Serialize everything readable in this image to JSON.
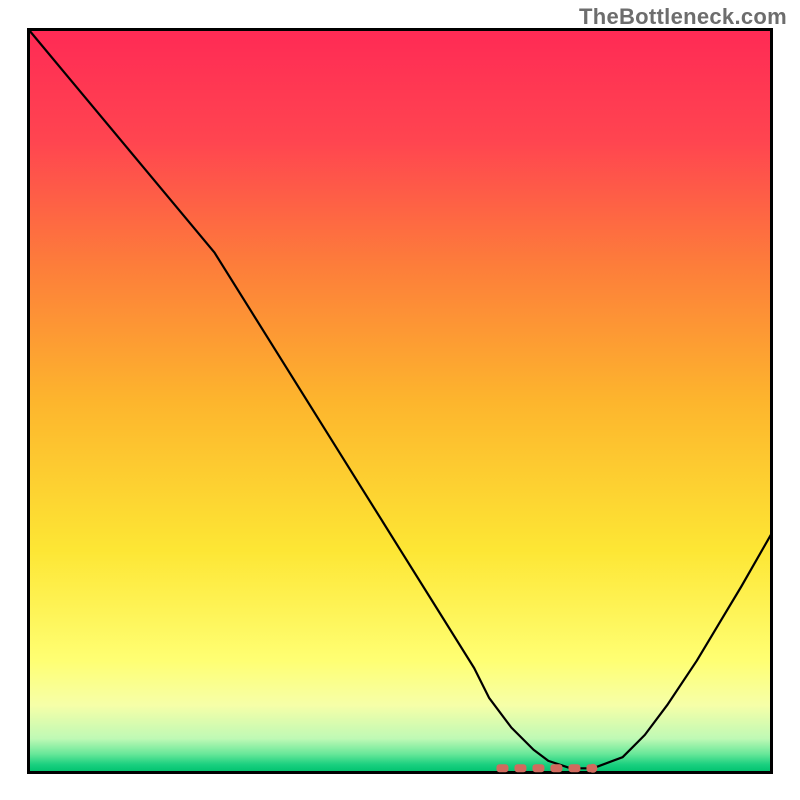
{
  "watermark": "TheBottleneck.com",
  "chart_data": {
    "type": "line",
    "title": "",
    "xlabel": "",
    "ylabel": "",
    "xlim": [
      0,
      100
    ],
    "ylim": [
      0,
      100
    ],
    "background_gradient": {
      "type": "vertical",
      "stops": [
        {
          "pos": 0.0,
          "color": "#FF2A55"
        },
        {
          "pos": 0.15,
          "color": "#FF4550"
        },
        {
          "pos": 0.32,
          "color": "#FD7E3A"
        },
        {
          "pos": 0.5,
          "color": "#FDB52D"
        },
        {
          "pos": 0.7,
          "color": "#FDE634"
        },
        {
          "pos": 0.85,
          "color": "#FFFF73"
        },
        {
          "pos": 0.91,
          "color": "#F6FFA8"
        },
        {
          "pos": 0.955,
          "color": "#BFF9B5"
        },
        {
          "pos": 0.975,
          "color": "#6BE89A"
        },
        {
          "pos": 0.99,
          "color": "#1AD07F"
        },
        {
          "pos": 1.0,
          "color": "#00C26F"
        }
      ]
    },
    "frame_color": "#000000",
    "series": [
      {
        "name": "bottleneck-curve",
        "color": "#000000",
        "x": [
          0,
          5,
          10,
          15,
          20,
          25,
          30,
          35,
          40,
          45,
          50,
          55,
          60,
          62,
          65,
          68,
          70,
          73,
          76,
          80,
          83,
          86,
          90,
          93,
          96,
          100
        ],
        "y": [
          100,
          94,
          88,
          82,
          76,
          70,
          62,
          54,
          46,
          38,
          30,
          22,
          14,
          10,
          6,
          3,
          1.5,
          0.5,
          0.5,
          2,
          5,
          9,
          15,
          20,
          25,
          32
        ]
      }
    ],
    "markers": [
      {
        "name": "optimal-region",
        "color": "#D16A5E",
        "shape": "dashed-bar",
        "y": 0.5,
        "x_start": 63,
        "x_end": 76
      }
    ]
  }
}
